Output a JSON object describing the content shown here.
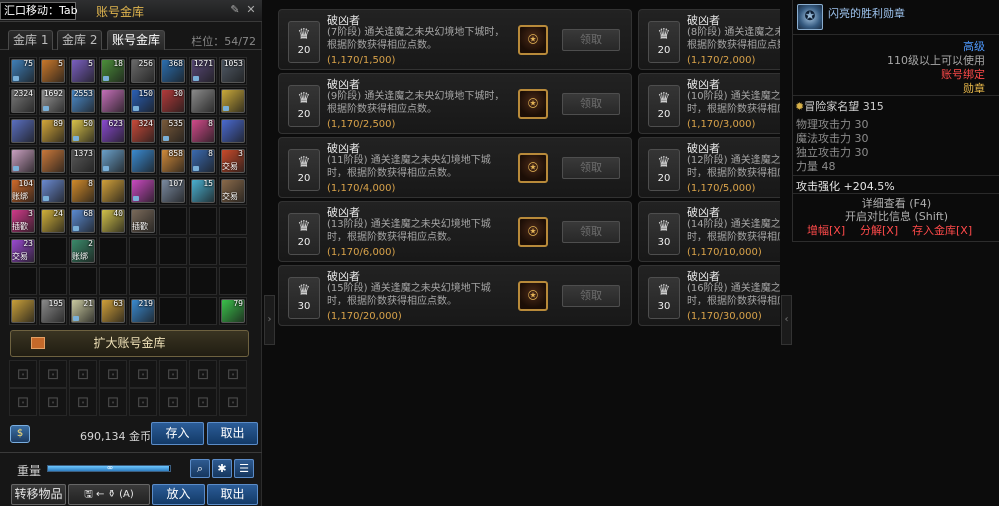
{
  "vault": {
    "hotkey_tip": "汇口移动：Tab",
    "title": "账号金库",
    "tabs": [
      "金库 1",
      "金库 2",
      "账号金库"
    ],
    "slots_label": "栏位：",
    "slots_value": "54/72",
    "items": [
      {
        "color": "#3f7fb8",
        "count": "75"
      },
      {
        "color": "#c9782b",
        "count": "5"
      },
      {
        "color": "#7a5fc0",
        "count": "5"
      },
      {
        "color": "#4b8f3a",
        "count": "18"
      },
      {
        "color": "#6a6a6a",
        "count": "256"
      },
      {
        "color": "#2b6fb0",
        "count": "368"
      },
      {
        "color": "#5a4a7a",
        "count": "1271"
      },
      {
        "color": "#505a66",
        "count": "1053"
      },
      {
        "color": "#7a7a7a",
        "count": "2324"
      },
      {
        "color": "#9a9a9a",
        "count": "1692"
      },
      {
        "color": "#4e8fd0",
        "count": "2553"
      },
      {
        "color": "#c46fb8",
        "count": ""
      },
      {
        "color": "#2a5fb5",
        "count": "150"
      },
      {
        "color": "#b23a3a",
        "count": "30"
      },
      {
        "color": "#8a8a8a",
        "count": ""
      },
      {
        "color": "#c9a93a",
        "count": ""
      },
      {
        "color": "#5a6fc0",
        "count": ""
      },
      {
        "color": "#d2a63a",
        "count": "89"
      },
      {
        "color": "#d7c14a",
        "count": "50"
      },
      {
        "color": "#8a4ad0",
        "count": "623"
      },
      {
        "color": "#c94a3a",
        "count": "324"
      },
      {
        "color": "#7a5a3a",
        "count": "535"
      },
      {
        "color": "#d04a8a",
        "count": "8"
      },
      {
        "color": "#4a6ad0",
        "count": ""
      },
      {
        "color": "#c9a0c0",
        "count": ""
      },
      {
        "color": "#c9783a",
        "count": ""
      },
      {
        "color": "#5a5a5a",
        "count": "1373"
      },
      {
        "color": "#6aa0c9",
        "count": ""
      },
      {
        "color": "#3a8ad0",
        "count": ""
      },
      {
        "color": "#d08a3a",
        "count": "858"
      },
      {
        "color": "#3a6ab0",
        "count": "8"
      },
      {
        "color": "#c94a2a",
        "count": "3",
        "tag": "交易"
      },
      {
        "color": "#d06a2a",
        "count": "104",
        "tag": "账绑"
      },
      {
        "color": "#6a8ad0",
        "count": ""
      },
      {
        "color": "#d08a2a",
        "count": "8"
      },
      {
        "color": "#d0a03a",
        "count": ""
      },
      {
        "color": "#c94ac0",
        "count": ""
      },
      {
        "color": "#7a8aa0",
        "count": "107"
      },
      {
        "color": "#4ab0d0",
        "count": "15"
      },
      {
        "color": "#8a6a4a",
        "count": "",
        "tag": "交易"
      },
      {
        "color": "#d03a8a",
        "count": "3",
        "tag": "插歡"
      },
      {
        "color": "#d0b03a",
        "count": "24"
      },
      {
        "color": "#5a8ad0",
        "count": "68"
      },
      {
        "color": "#d0c04a",
        "count": "40"
      },
      {
        "color": "#7a6a5a",
        "count": "",
        "tag": "插歡"
      },
      {
        "color": "",
        "count": ""
      },
      {
        "color": "",
        "count": ""
      },
      {
        "color": "",
        "count": ""
      },
      {
        "color": "#9a4ad0",
        "count": "23",
        "tag": "交易"
      },
      {
        "color": "",
        "count": ""
      },
      {
        "color": "#3a8a6a",
        "count": "2",
        "tag": "账绑"
      },
      {
        "color": "",
        "count": ""
      },
      {
        "color": "",
        "count": ""
      },
      {
        "color": "",
        "count": ""
      },
      {
        "color": "",
        "count": ""
      },
      {
        "color": "",
        "count": ""
      },
      {
        "color": "",
        "count": ""
      },
      {
        "color": "",
        "count": ""
      },
      {
        "color": "",
        "count": ""
      },
      {
        "color": "",
        "count": ""
      },
      {
        "color": "",
        "count": ""
      },
      {
        "color": "",
        "count": ""
      },
      {
        "color": "",
        "count": ""
      },
      {
        "color": "",
        "count": ""
      },
      {
        "color": "#c9a03a",
        "count": ""
      },
      {
        "color": "#8a8a8a",
        "count": "195"
      },
      {
        "color": "#c9c9a0",
        "count": "21"
      },
      {
        "color": "#d0a03a",
        "count": "63"
      },
      {
        "color": "#3a8ad0",
        "count": "219"
      },
      {
        "color": "",
        "count": ""
      },
      {
        "color": "",
        "count": ""
      },
      {
        "color": "#3ac04a",
        "count": "79"
      }
    ],
    "expand_label": "扩大账号金库",
    "gold_icon": "$",
    "gold_amount": "690,134",
    "gold_unit": "金币",
    "deposit_label": "存入",
    "withdraw_label": "取出",
    "weight_label": "重量",
    "weight_value": "∞",
    "weight_fraction": 0.99,
    "transfer_label": "转移物品",
    "transfer_shortcut": "🖫 ← ⚱ (A)",
    "put_in_label": "放入",
    "take_out_label": "取出",
    "icons": {
      "search": "search-icon",
      "settings": "gear-icon",
      "list": "list-icon",
      "lock": "lock-icon"
    }
  },
  "achievements": {
    "claim_label": "领取",
    "cards": [
      {
        "name": "破凶者",
        "stage": "(7阶段)",
        "desc": "通关逢魔之未央幻境地下城时，根据阶数获得相应点数。",
        "progress": "(1,170/1,500)",
        "points": "20"
      },
      {
        "name": "破凶者",
        "stage": "(8阶段)",
        "desc": "通关逢魔之未央幻境地下城时，根据阶数获得相应点数。",
        "progress": "(1,170/2,000)",
        "points": "20"
      },
      {
        "name": "破凶者",
        "stage": "(9阶段)",
        "desc": "通关逢魔之未央幻境地下城时，根据阶数获得相应点数。",
        "progress": "(1,170/2,500)",
        "points": "20"
      },
      {
        "name": "破凶者",
        "stage": "(10阶段)",
        "desc": "通关逢魔之未央幻境地下城时，根据阶数获得相应点数。",
        "progress": "(1,170/3,000)",
        "points": "20"
      },
      {
        "name": "破凶者",
        "stage": "(11阶段)",
        "desc": "通关逢魔之未央幻境地下城时，根据阶数获得相应点数。",
        "progress": "(1,170/4,000)",
        "points": "20"
      },
      {
        "name": "破凶者",
        "stage": "(12阶段)",
        "desc": "通关逢魔之未央幻境地下城时，根据阶数获得相应点数。",
        "progress": "(1,170/5,000)",
        "points": "20"
      },
      {
        "name": "破凶者",
        "stage": "(13阶段)",
        "desc": "通关逢魔之未央幻境地下城时，根据阶数获得相应点数。",
        "progress": "(1,170/6,000)",
        "points": "20"
      },
      {
        "name": "破凶者",
        "stage": "(14阶段)",
        "desc": "通关逢魔之未央幻境地下城时，根据阶数获得相应点数。",
        "progress": "(1,170/10,000)",
        "points": "30"
      },
      {
        "name": "破凶者",
        "stage": "(15阶段)",
        "desc": "通关逢魔之未央幻境地下城时，根据阶数获得相应点数。",
        "progress": "(1,170/20,000)",
        "points": "30"
      },
      {
        "name": "破凶者",
        "stage": "(16阶段)",
        "desc": "通关逢魔之未央幻境地下城时，根据阶数获得相应点数。",
        "progress": "(1,170/30,000)",
        "points": "30"
      }
    ]
  },
  "tooltip": {
    "name": "闪亮的胜利勋章",
    "grade": "高级",
    "level_req": "110级以上可以使用",
    "bind": "账号绑定",
    "type": "勋章",
    "fame_label": "冒险家名望",
    "fame_value": "315",
    "stats": [
      {
        "label": "物理攻击力",
        "value": "30"
      },
      {
        "label": "魔法攻击力",
        "value": "30"
      },
      {
        "label": "独立攻击力",
        "value": "30"
      },
      {
        "label": "力量",
        "value": "48"
      }
    ],
    "enhance_label": "攻击强化",
    "enhance_value": "+204.5%",
    "detail_label": "详细查看 (F4)",
    "compare_label": "开启对比信息 (Shift)",
    "actions": [
      "增幅[X]",
      "分解[X]",
      "存入金库[X]"
    ],
    "colors": {
      "name": "#9dc3ee",
      "grade": "#4f9aff",
      "bind": "#ff4a4a",
      "type": "#e8b84a",
      "action": "#ff4a4a"
    }
  }
}
